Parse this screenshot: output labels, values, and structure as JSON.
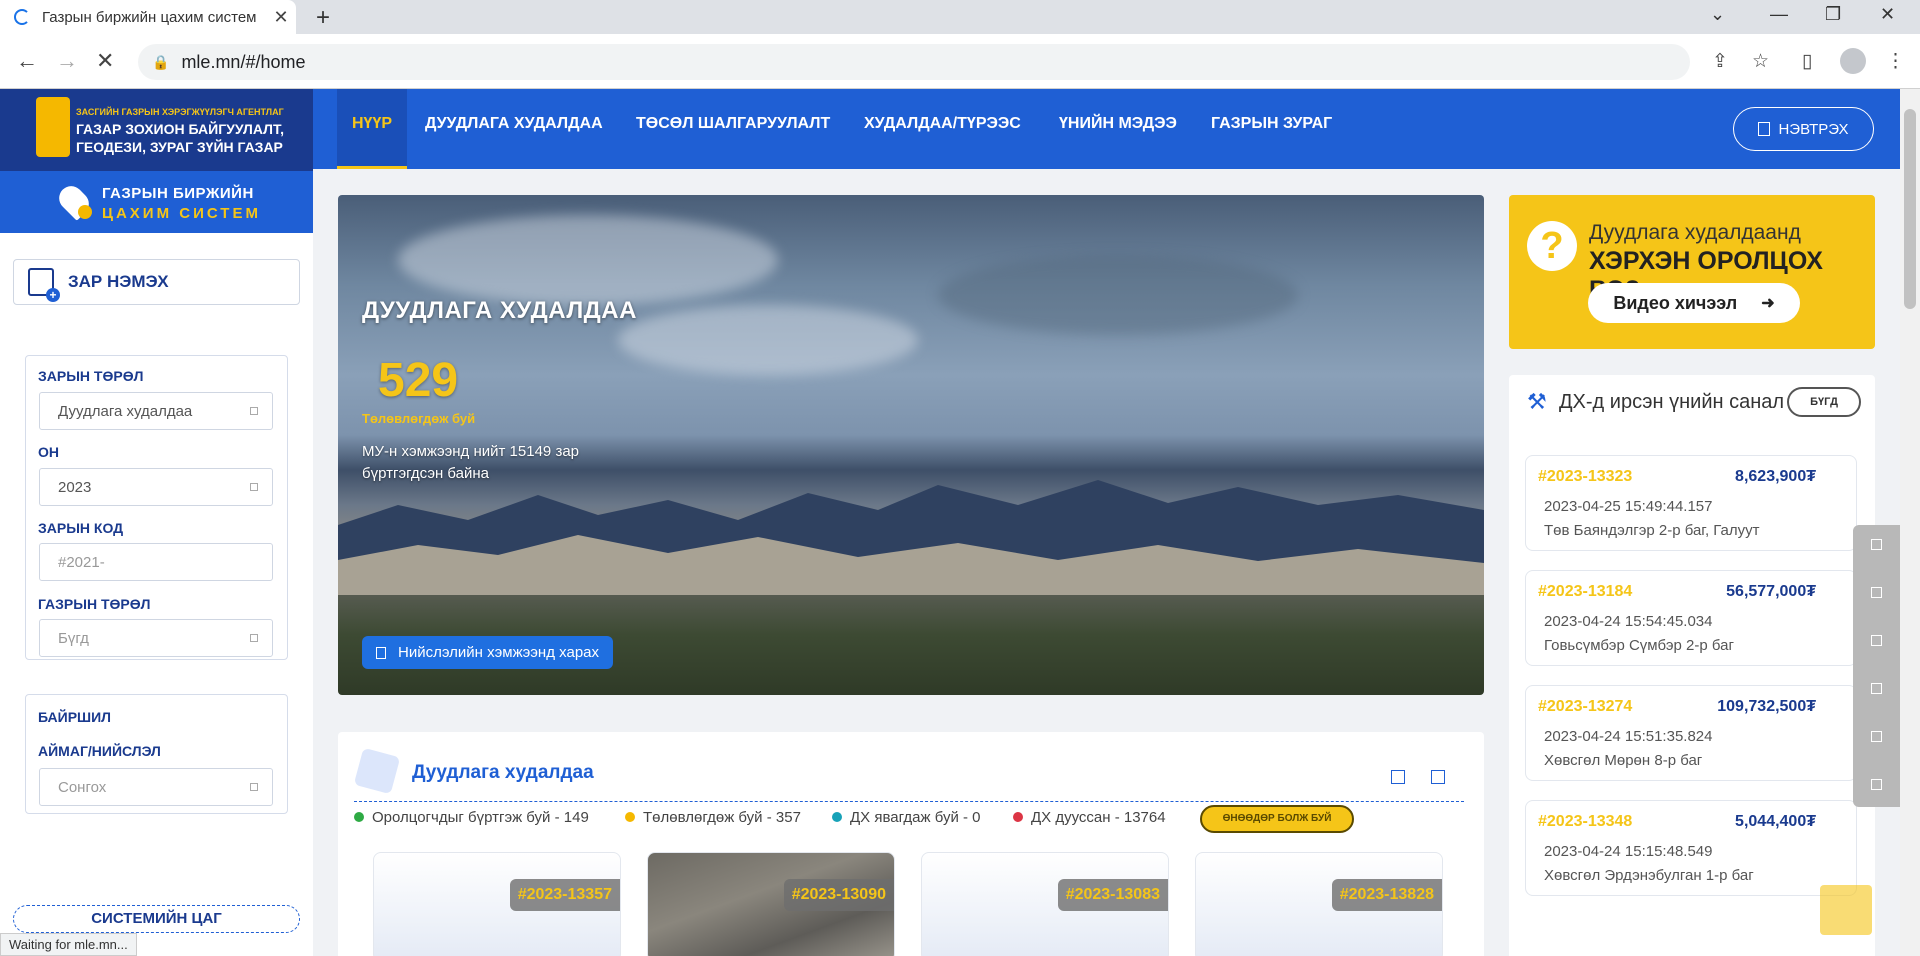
{
  "browser": {
    "tab_title": "Газрын биржийн цахим систем",
    "url": "mle.mn/#/home",
    "status": "Waiting for mle.mn..."
  },
  "logo": {
    "agency": "ЗАСГИЙН ГАЗРЫН ХЭРЭГЖҮҮЛЭГЧ АГЕНТЛАГ",
    "line1": "ГАЗАР ЗОХИОН БАЙГУУЛАЛТ,",
    "line2": "ГЕОДЕЗИ, ЗУРАГ ЗҮЙН ГАЗАР"
  },
  "system": {
    "title": "ГАЗРЫН БИРЖИЙН",
    "subtitle": "ЦАХИМ СИСТЕМ"
  },
  "sidebar": {
    "add_ad": "ЗАР НЭМЭХ",
    "filters": [
      {
        "label": "ЗАРЫН ТӨРӨЛ",
        "value": "Дуудлага худалдаа",
        "placeholder": ""
      },
      {
        "label": "ОН",
        "value": "2023",
        "placeholder": ""
      },
      {
        "label": "ЗАРЫН КОД",
        "value": "",
        "placeholder": "#2021-"
      },
      {
        "label": "ГАЗРЫН ТӨРӨЛ",
        "value": "",
        "placeholder": "Бүгд"
      }
    ],
    "location": {
      "title": "БАЙРШИЛ",
      "label": "АЙМАГ/НИЙСЛЭЛ",
      "placeholder": "Сонгох"
    },
    "system_time": "СИСТЕМИЙН ЦАГ"
  },
  "nav": {
    "items": [
      "НҮҮР",
      "ДУУДЛАГА ХУДАЛДАА",
      "ТӨСӨЛ ШАЛГАРУУЛАЛТ",
      "ХУДАЛДАА/ТҮРЭЭС",
      "ҮНИЙН МЭДЭЭ",
      "ГАЗРЫН ЗУРАГ"
    ],
    "active": "НҮҮР",
    "login": "НЭВТРЭХ"
  },
  "hero": {
    "title": "ДУУДЛАГА ХУДАЛДАА",
    "count": "529",
    "count_label": "Төлөвлөгдөж буй",
    "description": "МУ-н хэмжээнд нийт 15149 зар бүртгэгдсэн байна",
    "button": "Нийслэлийн хэмжээнд харах"
  },
  "auctions": {
    "title": "Дуудлага худалдаа",
    "legend": [
      {
        "text": "Оролцогчдыг бүртгэж буй - 149",
        "color": "#2eaa44"
      },
      {
        "text": "Төлөвлөгдөж буй - 357",
        "color": "#f5b800"
      },
      {
        "text": "ДХ явагдаж буй - 0",
        "color": "#17a2b8"
      },
      {
        "text": "ДХ дууссан - 13764",
        "color": "#dc3545"
      }
    ],
    "today_button": "ӨНӨӨДӨР БОЛЖ БУЙ",
    "cards": [
      "#2023-13357",
      "#2023-13090",
      "#2023-13083",
      "#2023-13828"
    ]
  },
  "help": {
    "line1": "Дуудлага худалдаанд",
    "line2": "ХЭРХЭН ОРОЛЦОХ ВЭ?",
    "button": "Видео хичээл"
  },
  "bids": {
    "title": "ДХ-д ирсэн үнийн санал",
    "all_button": "БҮГД",
    "items": [
      {
        "code": "#2023-13323",
        "amount": "8,623,900₮",
        "time": "2023-04-25 15:49:44.157",
        "location": "Төв Баяндэлгэр 2-р баг, Галуут"
      },
      {
        "code": "#2023-13184",
        "amount": "56,577,000₮",
        "time": "2023-04-24 15:54:45.034",
        "location": "Говьсүмбэр Сүмбэр 2-р баг"
      },
      {
        "code": "#2023-13274",
        "amount": "109,732,500₮",
        "time": "2023-04-24 15:51:35.824",
        "location": "Хөвсгөл Мөрөн 8-р баг"
      },
      {
        "code": "#2023-13348",
        "amount": "5,044,400₮",
        "time": "2023-04-24 15:15:48.549",
        "location": "Хөвсгөл Эрдэнэбулган 1-р баг"
      }
    ]
  },
  "colors": {
    "primary": "#1f5fd4",
    "navy": "#1a3a8e",
    "accent": "#f5c518"
  }
}
